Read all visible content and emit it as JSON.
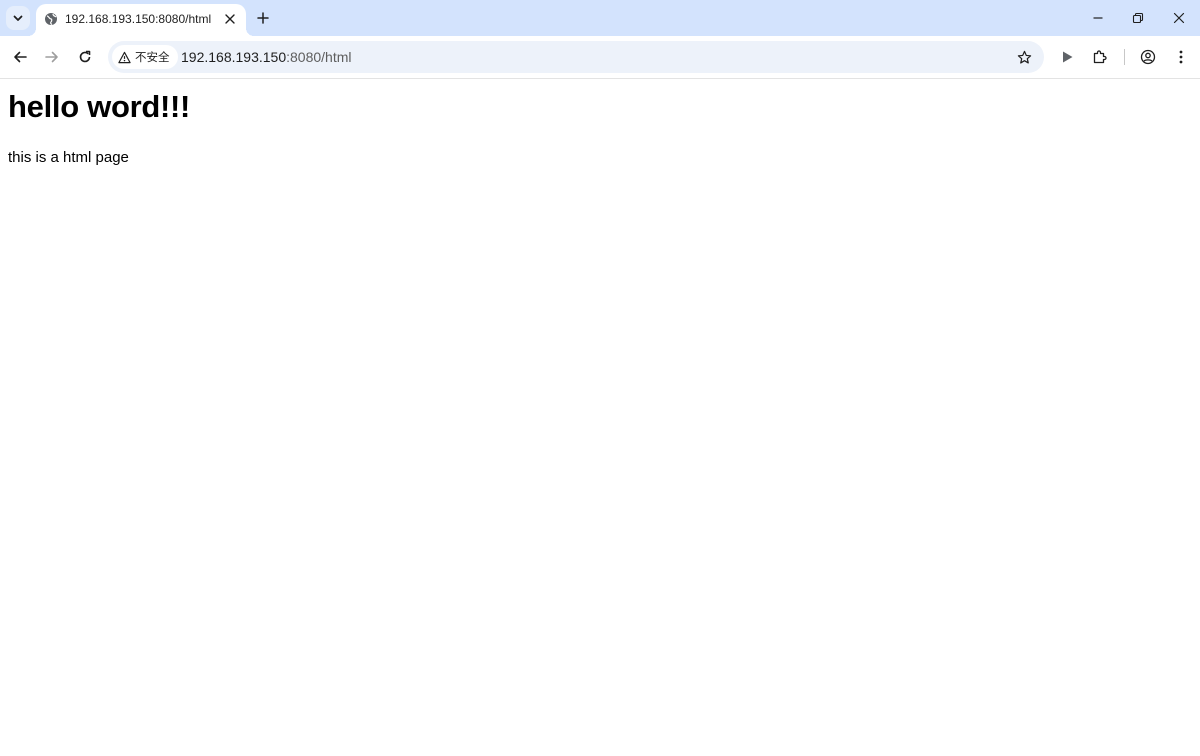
{
  "browser": {
    "tab": {
      "title": "192.168.193.150:8080/html"
    },
    "address_bar": {
      "security_label": "不安全",
      "url_host": "192.168.193.150",
      "url_rest": ":8080/html"
    },
    "icons": {
      "tab_search": "chevron-down-icon",
      "favicon": "globe-icon",
      "tab_close": "close-icon",
      "new_tab": "plus-icon",
      "minimize": "minimize-icon",
      "restore": "restore-icon",
      "close_window": "close-icon",
      "back": "arrow-left-icon",
      "forward": "arrow-right-icon",
      "reload": "reload-icon",
      "not_secure": "warning-triangle-icon",
      "bookmark": "star-icon",
      "media": "play-icon",
      "extensions": "puzzle-icon",
      "profile": "profile-icon",
      "menu": "kebab-menu-icon"
    },
    "colors": {
      "tabbar_bg": "#d3e3fd",
      "omnibox_bg": "#edf2fa",
      "icon": "#474747"
    }
  },
  "page": {
    "heading": "hello word!!!",
    "paragraph": "this is a html page"
  }
}
